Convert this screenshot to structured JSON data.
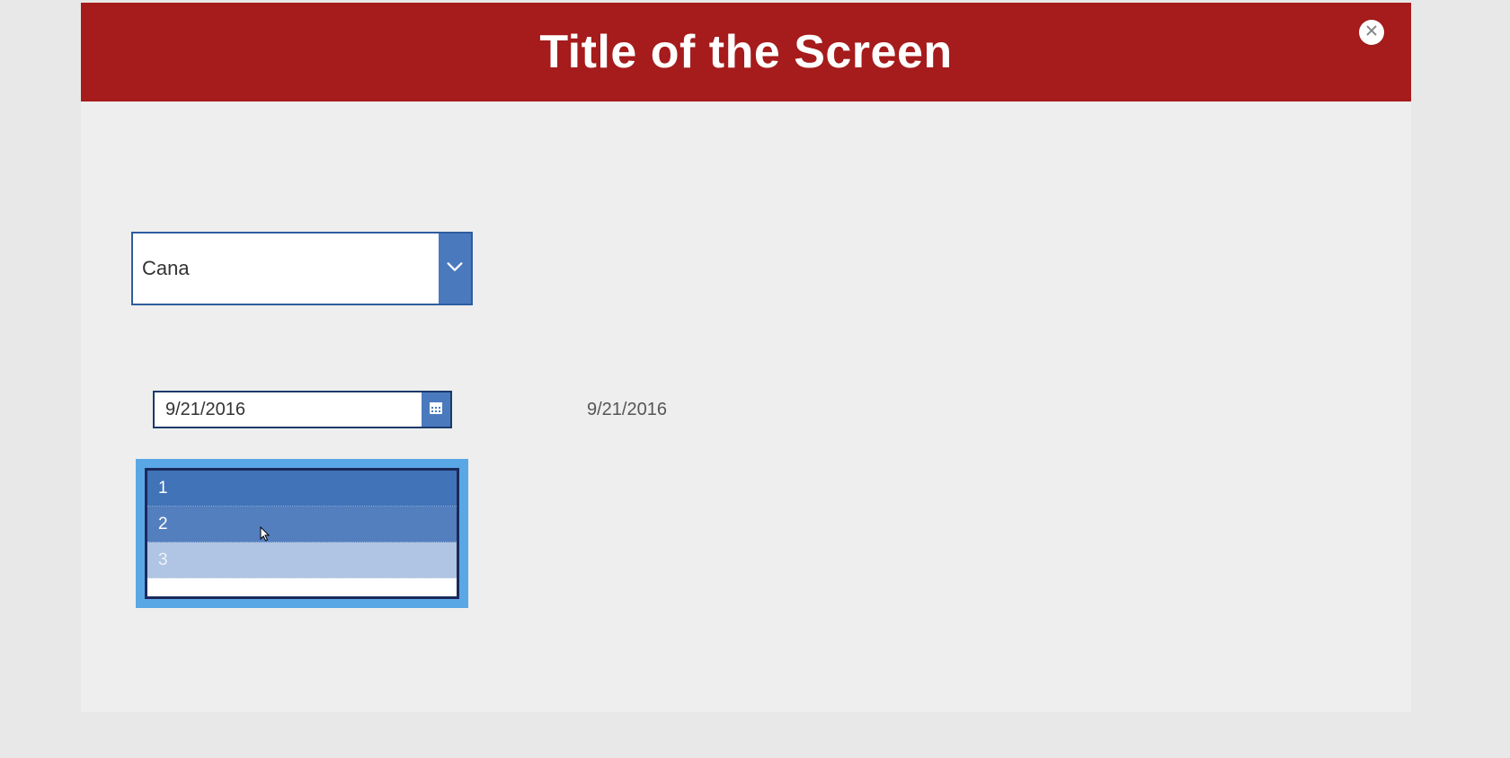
{
  "header": {
    "title": "Title of the Screen"
  },
  "combobox": {
    "value": "Cana"
  },
  "datepicker": {
    "value": "9/21/2016"
  },
  "date_display": "9/21/2016",
  "listbox": {
    "items": [
      "1",
      "2",
      "3"
    ]
  },
  "colors": {
    "header_bg": "#a61b1b",
    "accent_blue": "#4a79bd",
    "listbox_focus": "#5aa7e6"
  }
}
